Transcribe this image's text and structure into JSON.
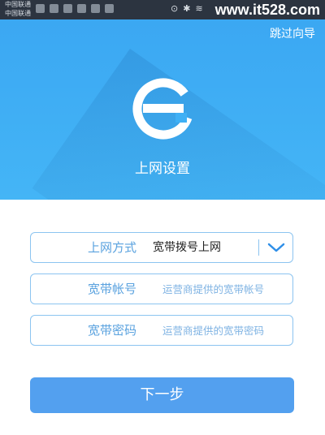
{
  "status_bar": {
    "carrier_line1": "中国联通",
    "carrier_line2": "中国联通",
    "watermark": "www.it528.com"
  },
  "header": {
    "skip_label": "跳过向导",
    "title": "上网设置",
    "logo_icon": "e-logo-icon"
  },
  "form": {
    "connection": {
      "label": "上网方式",
      "value": "宽带拨号上网"
    },
    "account": {
      "label": "宽带帐号",
      "placeholder": "运营商提供的宽带帐号"
    },
    "password": {
      "label": "宽带密码",
      "placeholder": "运营商提供的宽带密码"
    }
  },
  "actions": {
    "next_label": "下一步"
  },
  "colors": {
    "hero_blue": "#3aa6f2",
    "accent_blue": "#53a0ef",
    "label_blue": "#5aa2df",
    "border_blue": "#8cc4f0"
  }
}
